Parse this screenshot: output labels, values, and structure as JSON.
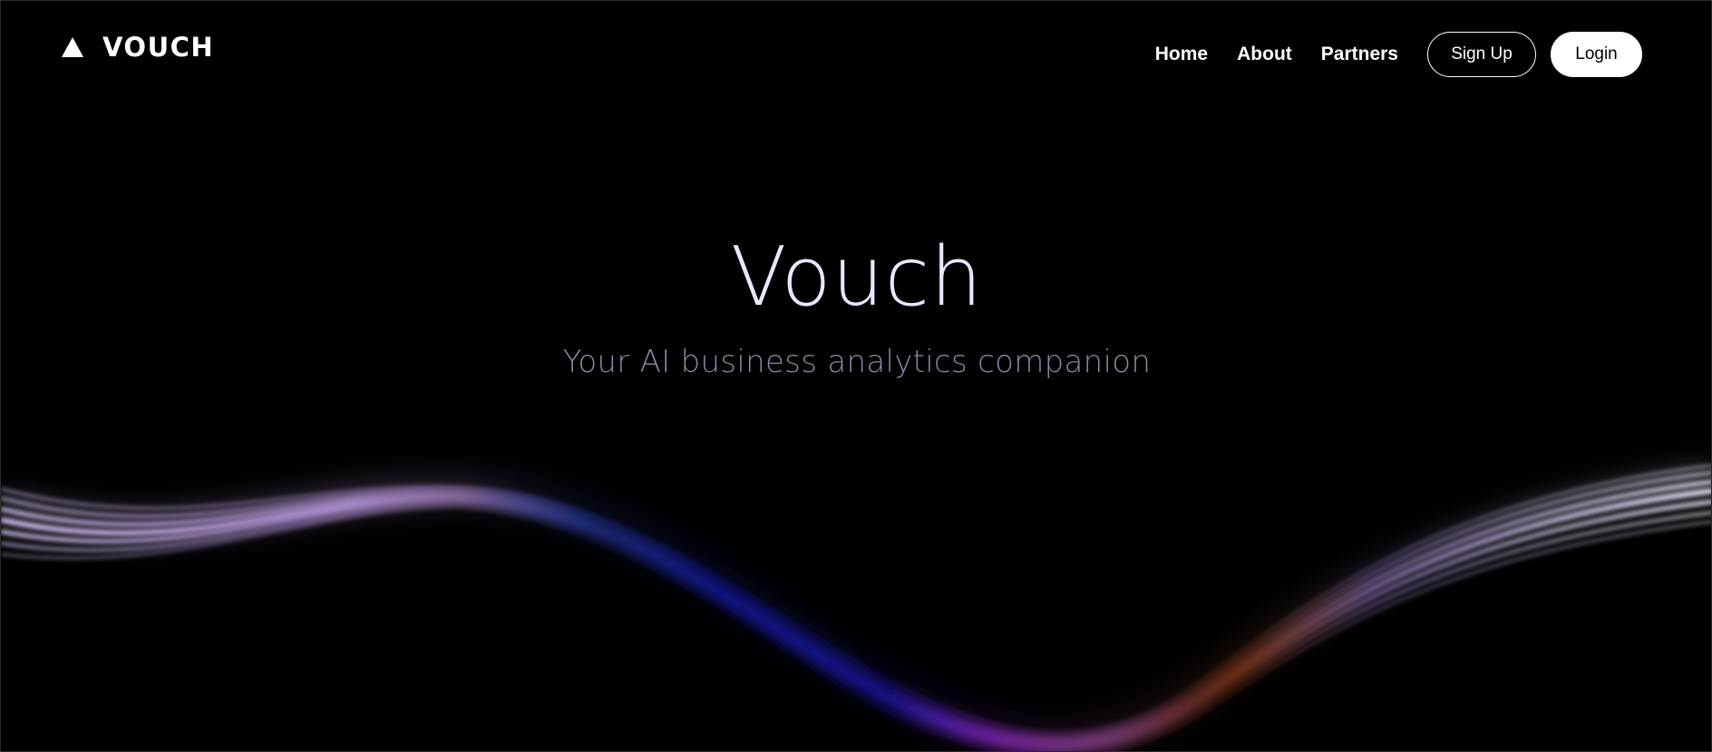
{
  "brand": {
    "logo_icon": "triangle-icon",
    "name": "VOUCH"
  },
  "nav": {
    "links": [
      {
        "label": "Home"
      },
      {
        "label": "About"
      },
      {
        "label": "Partners"
      }
    ],
    "signup_label": "Sign Up",
    "login_label": "Login"
  },
  "hero": {
    "title": "Vouch",
    "subtitle": "Your AI business analytics companion"
  },
  "colors": {
    "background": "#000000",
    "text": "#ffffff",
    "title": "#e6e9ff",
    "subtitle": "#8a87a6",
    "wave_lavender": "#c9a8f0",
    "wave_blue": "#1f2bff",
    "wave_purple": "#9b3cff",
    "wave_orange": "#ff5a1f"
  }
}
